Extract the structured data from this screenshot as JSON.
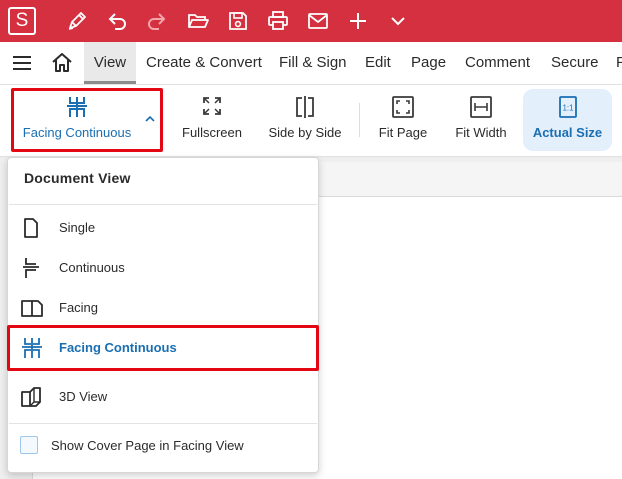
{
  "window": {
    "app_logo_letter": "S",
    "quick_access_icons": [
      "pen-icon",
      "undo-icon",
      "redo-icon",
      "open-folder-icon",
      "save-icon",
      "print-icon",
      "mail-icon",
      "plus-icon",
      "chevron-down-icon"
    ]
  },
  "menubar": {
    "tabs": [
      {
        "label": "View",
        "active": true
      },
      {
        "label": "Create & Convert"
      },
      {
        "label": "Fill & Sign"
      },
      {
        "label": "Edit"
      },
      {
        "label": "Page"
      },
      {
        "label": "Comment"
      },
      {
        "label": "Secure"
      },
      {
        "label": "F"
      }
    ]
  },
  "ribbon": {
    "buttons": [
      {
        "label": "Facing Continuous",
        "icon": "facing-continuous-icon"
      },
      {
        "label": "Fullscreen",
        "icon": "fullscreen-icon"
      },
      {
        "label": "Side by Side",
        "icon": "side-by-side-icon"
      },
      {
        "label": "Fit Page",
        "icon": "fit-page-icon"
      },
      {
        "label": "Fit Width",
        "icon": "fit-width-icon"
      },
      {
        "label": "Actual Size",
        "icon": "actual-size-icon",
        "icon_text": "1:1",
        "selected": true
      }
    ]
  },
  "document_view_menu": {
    "title": "Document View",
    "items": [
      {
        "label": "Single",
        "icon": "single-page-icon"
      },
      {
        "label": "Continuous",
        "icon": "continuous-icon"
      },
      {
        "label": "Facing",
        "icon": "facing-icon"
      },
      {
        "label": "Facing Continuous",
        "icon": "facing-continuous-icon",
        "selected": true
      },
      {
        "label": "3D View",
        "icon": "3d-view-icon"
      }
    ],
    "checkbox": {
      "label": "Show Cover Page in Facing View",
      "checked": false
    }
  },
  "colors": {
    "titlebar": "#d5303f",
    "accent_blue": "#1a6fb3",
    "highlight_outline": "#e30613",
    "selected_button_bg": "#e3effb"
  }
}
